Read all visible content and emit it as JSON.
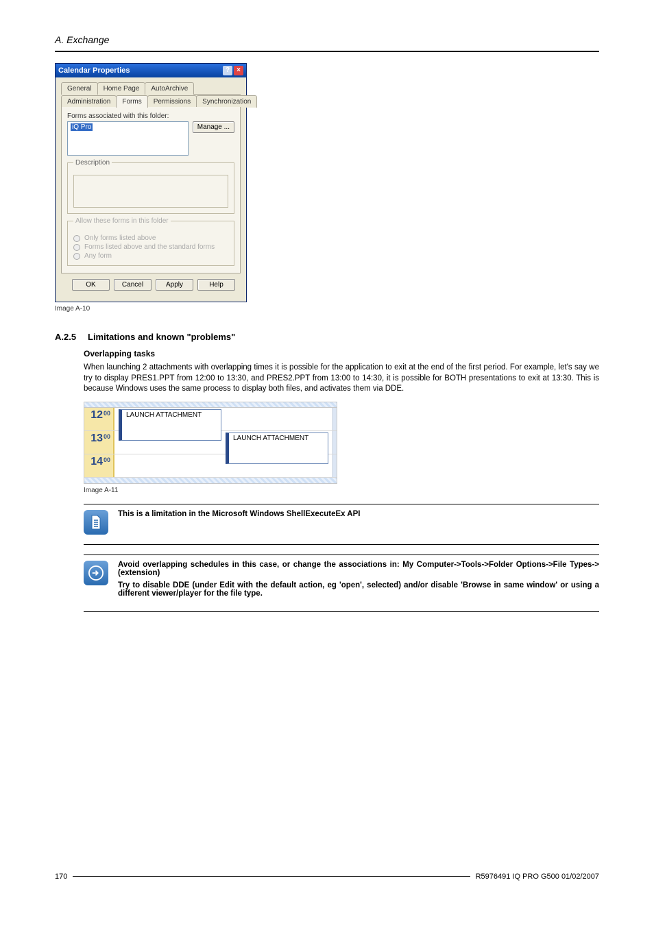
{
  "header": {
    "title": "A. Exchange"
  },
  "dialog": {
    "title": "Calendar Properties",
    "tabs_row1": [
      "General",
      "Home Page",
      "AutoArchive"
    ],
    "tabs_row2": [
      "Administration",
      "Forms",
      "Permissions",
      "Synchronization"
    ],
    "forms_label": "Forms associated with this folder:",
    "selected_form": "iQ Pro",
    "manage_btn": "Manage ...",
    "description_legend": "Description",
    "allow_legend": "Allow these forms in this folder",
    "radio_only": "Only forms listed above",
    "radio_listed_std": "Forms listed above and the standard forms",
    "radio_any": "Any form",
    "ok": "OK",
    "cancel": "Cancel",
    "apply": "Apply",
    "help": "Help"
  },
  "caption1": "Image A-10",
  "section": {
    "num": "A.2.5",
    "title": "Limitations and known \"problems\"",
    "sub": "Overlapping tasks",
    "para": "When launching 2 attachments with overlapping times it is possible for the application to exit at the end of the first period. For example, let's say we try to display PRES1.PPT from 12:00 to 13:30, and PRES2.PPT from 13:00 to 14:30, it is possible for BOTH presentations to exit at 13:30. This is because Windows uses the same process to display both files, and activates them via DDE."
  },
  "calendar": {
    "rows": [
      {
        "hour": "12",
        "min": "00"
      },
      {
        "hour": "13",
        "min": "00"
      },
      {
        "hour": "14",
        "min": "00"
      }
    ],
    "item1": "LAUNCH ATTACHMENT",
    "item2": "LAUNCH ATTACHMENT"
  },
  "caption2": "Image A-11",
  "note1": "This is a limitation in the Microsoft Windows ShellExecuteEx API",
  "note2a": "Avoid overlapping schedules in this case, or change the associations in: My Computer->Tools->Folder Options->File Types->(extension)",
  "note2b": "Try to disable DDE (under Edit with the default action, eg 'open', selected) and/or disable 'Browse in same window' or using a different viewer/player for the file type.",
  "footer": {
    "page": "170",
    "ref": "R5976491 IQ PRO G500 01/02/2007"
  }
}
